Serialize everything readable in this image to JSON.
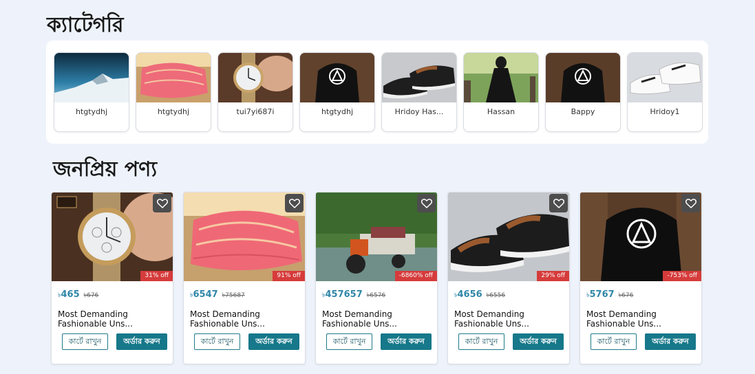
{
  "categories_section": {
    "title": "ক্যাটেগরি",
    "items": [
      {
        "label": "htgtydhj",
        "icon": "mountain-image"
      },
      {
        "label": "htgtydhj",
        "icon": "quilt-image"
      },
      {
        "label": "tui7yi687i",
        "icon": "watch-image"
      },
      {
        "label": "htgtydhj",
        "icon": "hoodie-image"
      },
      {
        "label": "Hridoy Has...",
        "icon": "shoes-image"
      },
      {
        "label": "Hassan",
        "icon": "dress-image"
      },
      {
        "label": "Bappy",
        "icon": "hoodie-image"
      },
      {
        "label": "Hridoy1",
        "icon": "sneakers-image"
      }
    ]
  },
  "popular_section": {
    "title": "জনপ্রিয় পণ্য",
    "currency": "৳",
    "cart_label": "কার্টে রাখুন",
    "order_label": "অর্ডার করুন",
    "products": [
      {
        "price": "465",
        "old_price": "৳676",
        "discount": "31% off",
        "name": "Most Demanding Fashionable Uns...",
        "icon": "watch-image"
      },
      {
        "price": "6547",
        "old_price": "৳75687",
        "discount": "91% off",
        "name": "Most Demanding Fashionable Uns...",
        "icon": "quilt-image"
      },
      {
        "price": "457657",
        "old_price": "৳6576",
        "discount": "-6860% off",
        "name": "Most Demanding Fashionable Uns...",
        "icon": "tractor-image"
      },
      {
        "price": "4656",
        "old_price": "৳6556",
        "discount": "29% off",
        "name": "Most Demanding Fashionable Uns...",
        "icon": "shoes-image"
      },
      {
        "price": "5767",
        "old_price": "৳676",
        "discount": "-753% off",
        "name": "Most Demanding Fashionable Uns...",
        "icon": "hoodie-image"
      }
    ]
  },
  "colors": {
    "background": "#eef3fb",
    "price": "#2f86a8",
    "discount_badge": "#d63b3b",
    "order_button": "#16788a"
  }
}
